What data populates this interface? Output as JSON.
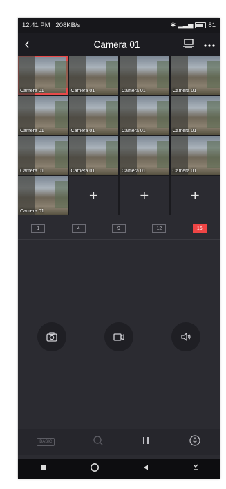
{
  "status": {
    "time_speed": "12:41 PM | 208KB/s",
    "battery": "81"
  },
  "header": {
    "title": "Camera 01"
  },
  "grid": {
    "camera_label": "Camera 01",
    "add_symbol": "+"
  },
  "layouts": [
    "1",
    "4",
    "9",
    "12",
    "16"
  ],
  "active_layout": "16",
  "toolbar": {
    "basic_label": "BASIC"
  },
  "icons": [
    "back-icon",
    "display-icon",
    "more-icon",
    "snapshot-icon",
    "record-icon",
    "audio-icon",
    "search-icon",
    "pause-icon",
    "talk-icon"
  ],
  "colors": {
    "accent": "#ef4545",
    "background": "#2b2b31"
  }
}
